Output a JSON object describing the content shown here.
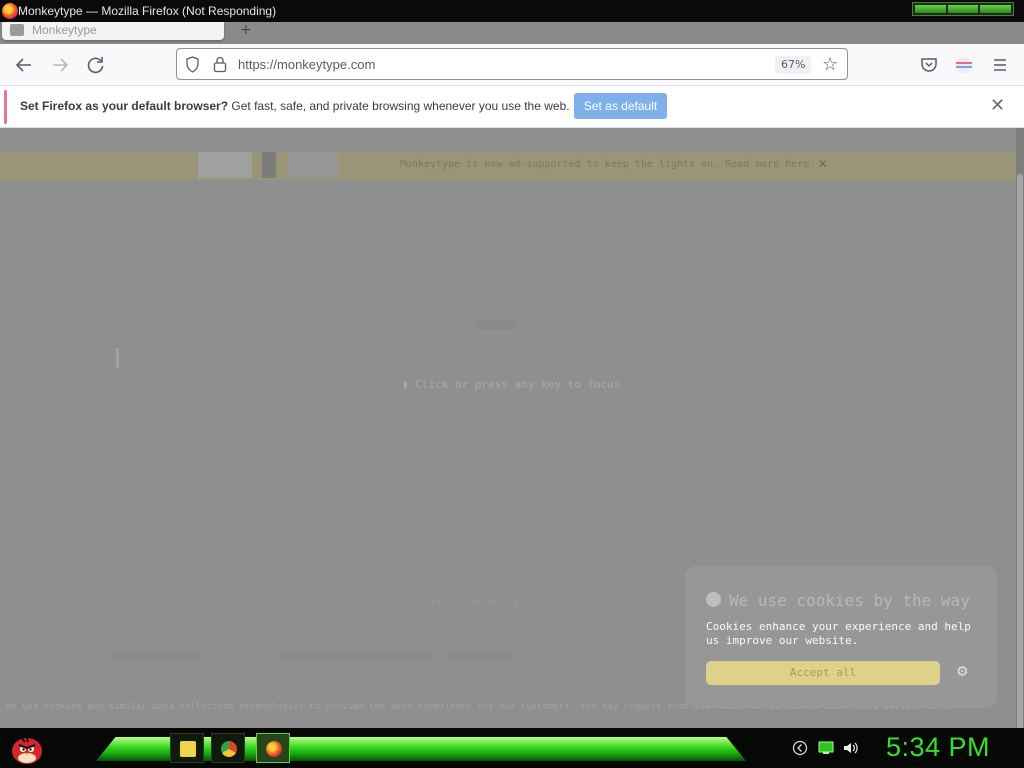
{
  "window": {
    "title": "Monkeytype — Mozilla Firefox (Not Responding)"
  },
  "tab": {
    "label": "Monkeytype",
    "new_tab_symbol": "+"
  },
  "navbar": {
    "back_icon": "back-arrow-icon",
    "forward_icon": "forward-arrow-icon",
    "reload_icon": "reload-icon",
    "url": "https://monkeytype.com",
    "zoom": "67%"
  },
  "infobar": {
    "bold_text": "Set Firefox as your default browser?",
    "text": " Get fast, safe, and private browsing whenever you use the web.",
    "button": "Set as default",
    "close": "✕"
  },
  "page": {
    "focus_hint": "Click or press any key to focus",
    "banner_text": "Monkeytype is now ad-supported to keep the lights on. Read more here.",
    "banner_link": "Read more here",
    "footer_text": "ctrl + shift + p",
    "consent_strip": "We use cookies and similar data collection technologies to provide the best experience for our customers. You may request that your data not be shared with third parties here."
  },
  "cookie_popup": {
    "title": "We use cookies by the way",
    "body": "Cookies enhance your experience and help us improve our website.",
    "accept_button": "Accept all"
  },
  "taskbar": {
    "clock": "5:34 PM"
  },
  "colors": {
    "accent_green": "#36e02a",
    "firefox_blue_button": "#7fb0ea",
    "overlay_grey": "#8f8f8f"
  }
}
